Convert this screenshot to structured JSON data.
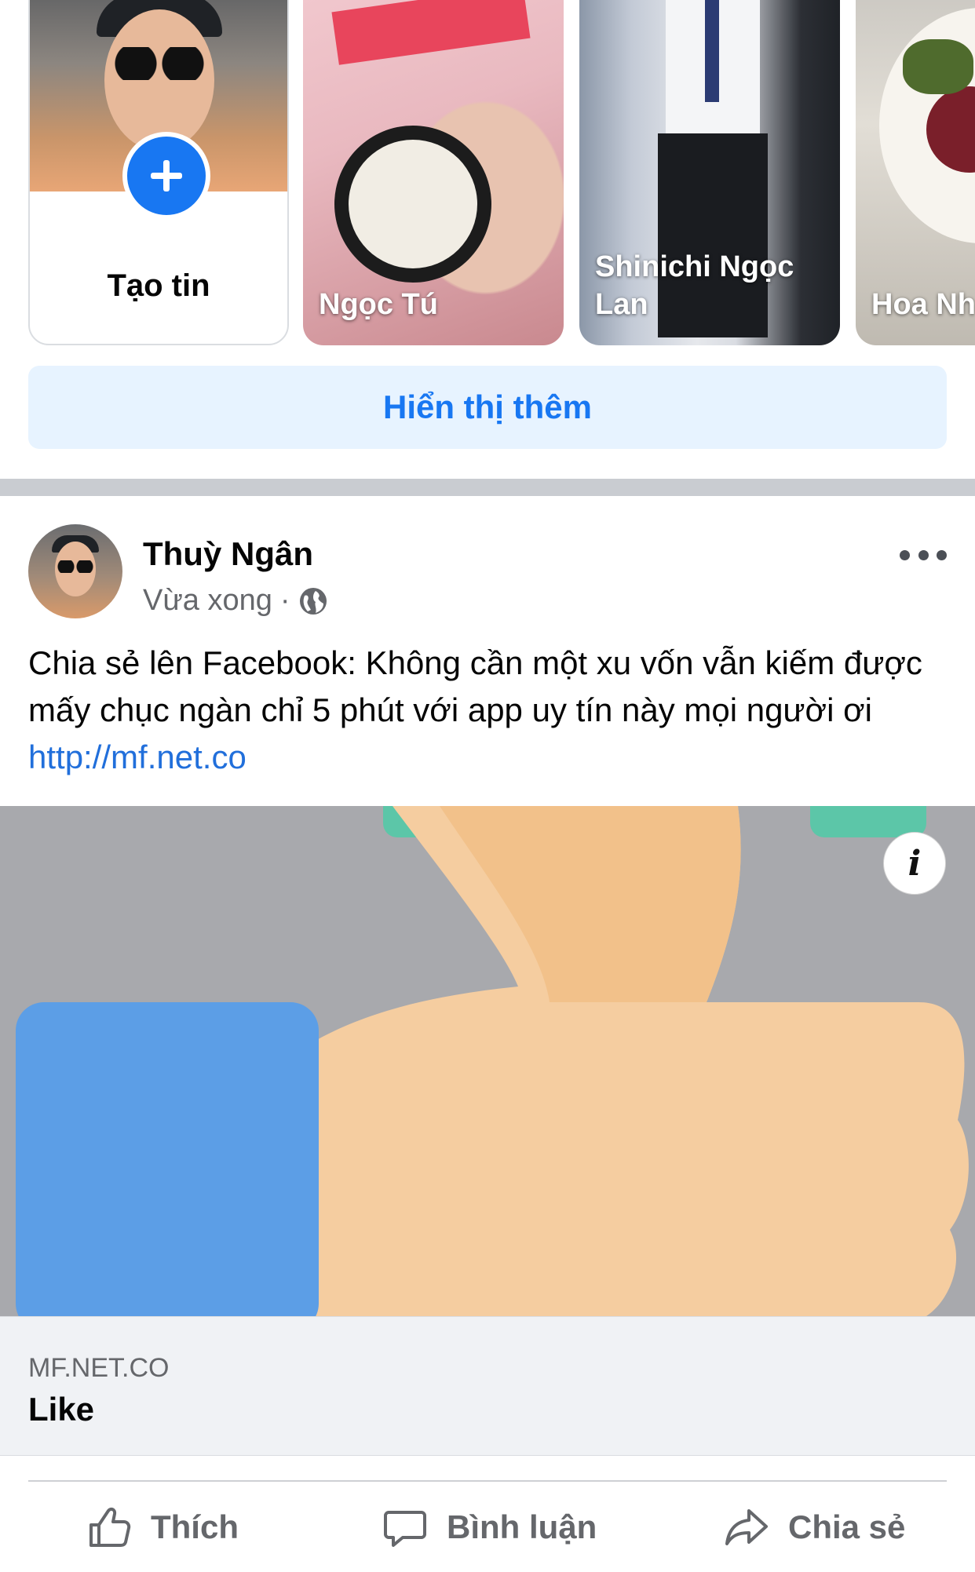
{
  "stories": {
    "create_label": "Tạo tin",
    "items": [
      {
        "name": "Ngọc Tú"
      },
      {
        "name": "Shinichi Ngọc Lan"
      },
      {
        "name": "Hoa Nh"
      }
    ],
    "show_more": "Hiển thị thêm"
  },
  "post": {
    "author": "Thuỳ Ngân",
    "time": "Vừa xong",
    "separator": "·",
    "privacy_icon": "globe-icon",
    "text": "Chia sẻ lên Facebook: Không cần một xu vốn vẫn kiếm được mấy chục ngàn chỉ 5 phút với app uy tín này mọi người ơi",
    "link": "http://mf.net.co",
    "info_label": "i",
    "link_card": {
      "domain": "MF.NET.CO",
      "title": "Like"
    },
    "actions": {
      "like": "Thích",
      "comment": "Bình luận",
      "share": "Chia sẻ"
    }
  },
  "colors": {
    "accent": "#1877f2",
    "show_more_bg": "#e7f3ff",
    "link_image_bg": "#a8a9ad",
    "thumb_skin": "#f5cda0",
    "thumb_sleeve": "#5c9ee6",
    "thumb_cuff": "#5cc6a8"
  }
}
